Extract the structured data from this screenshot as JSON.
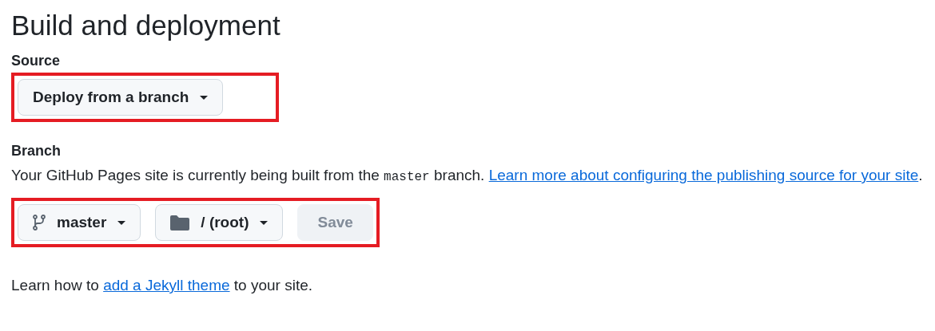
{
  "title": "Build and deployment",
  "source": {
    "label": "Source",
    "highlighted": true,
    "dropdown": "Deploy from a branch"
  },
  "branch": {
    "label": "Branch",
    "description": {
      "before": "Your GitHub Pages site is currently being built from the ",
      "code": "master",
      "after": " branch. ",
      "link": "Learn more about configuring the publishing source for your site",
      "end": "."
    },
    "highlighted": true,
    "branch_dropdown": "master",
    "folder_dropdown": "/ (root)",
    "save": {
      "label": "Save",
      "disabled": true
    }
  },
  "footer": {
    "before": "Learn how to ",
    "link": "add a Jekyll theme",
    "after": " to your site."
  }
}
